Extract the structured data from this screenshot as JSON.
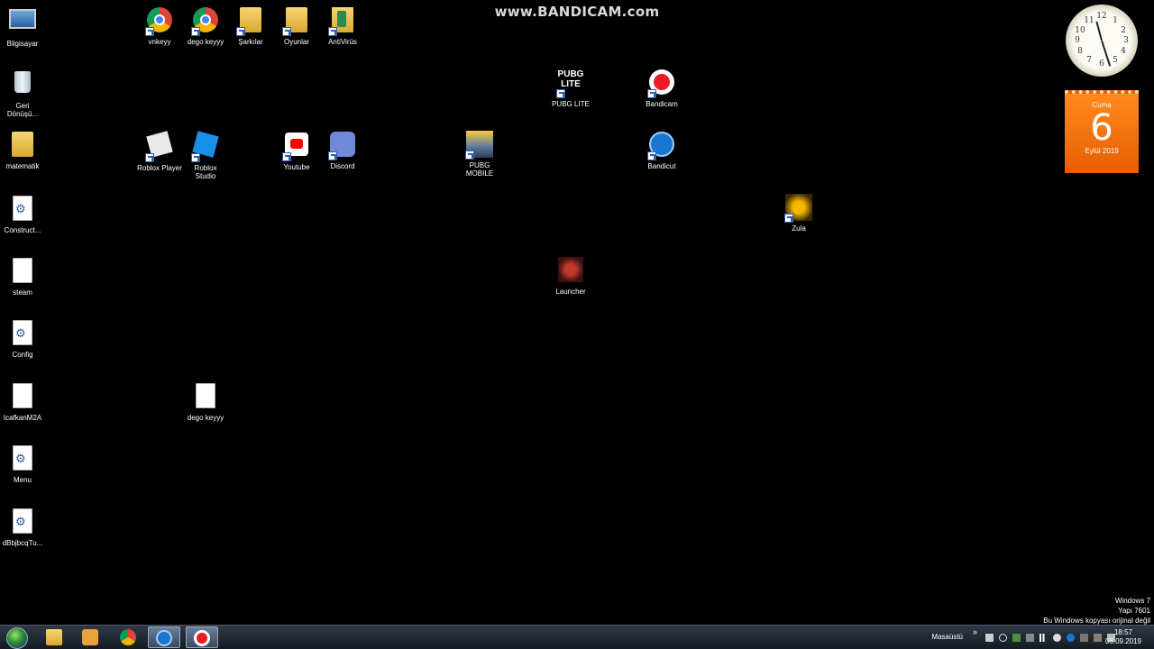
{
  "watermark": "www.BANDICAM.com",
  "desktop_icons": {
    "bilgisayar": "Bilgisayar",
    "geri": "Geri\nDönüşü...",
    "matematik": "matematik",
    "construct": "Construct...",
    "steam": "steam",
    "config": "Config",
    "icafkan": "IcafkanM2A",
    "menu": "Menu",
    "dbb": "dBbjbcqTu...",
    "vnkeyy": "vnkeyy",
    "dego_keyyy": "dego keyyy",
    "sarkilar": "Şarkılar",
    "oyunlar": "Oyunlar",
    "antivirus": "AntiVirüs",
    "roblox_player": "Roblox Player",
    "roblox_studio": "Roblox\nStudio",
    "youtube": "Youtube",
    "discord": "Discord",
    "pubg_mobile": "PUBG\nMOBILE",
    "pubg_lite": "PUBG LITE",
    "bandicam": "Bandicam",
    "bandicut": "Bandicut",
    "zula": "Zula",
    "launcher": "Launcher",
    "dego_keyyy_file": "dego keyyy"
  },
  "pubg_lite_logo": "PUBG\nLITE",
  "clock_numbers": [
    "12",
    "1",
    "2",
    "3",
    "4",
    "5",
    "6",
    "7",
    "8",
    "9",
    "10",
    "11"
  ],
  "calendar": {
    "weekday": "Cuma",
    "day": "6",
    "month_year": "Eylül 2019"
  },
  "notice": {
    "line1": "Windows 7",
    "line2": "Yapı 7601",
    "line3": "Bu Windows kopyası orijinal değil"
  },
  "taskbar": {
    "desktop_label": "Masaüstü",
    "chevron": "»",
    "time": "18:57",
    "date": "06.09.2019"
  }
}
